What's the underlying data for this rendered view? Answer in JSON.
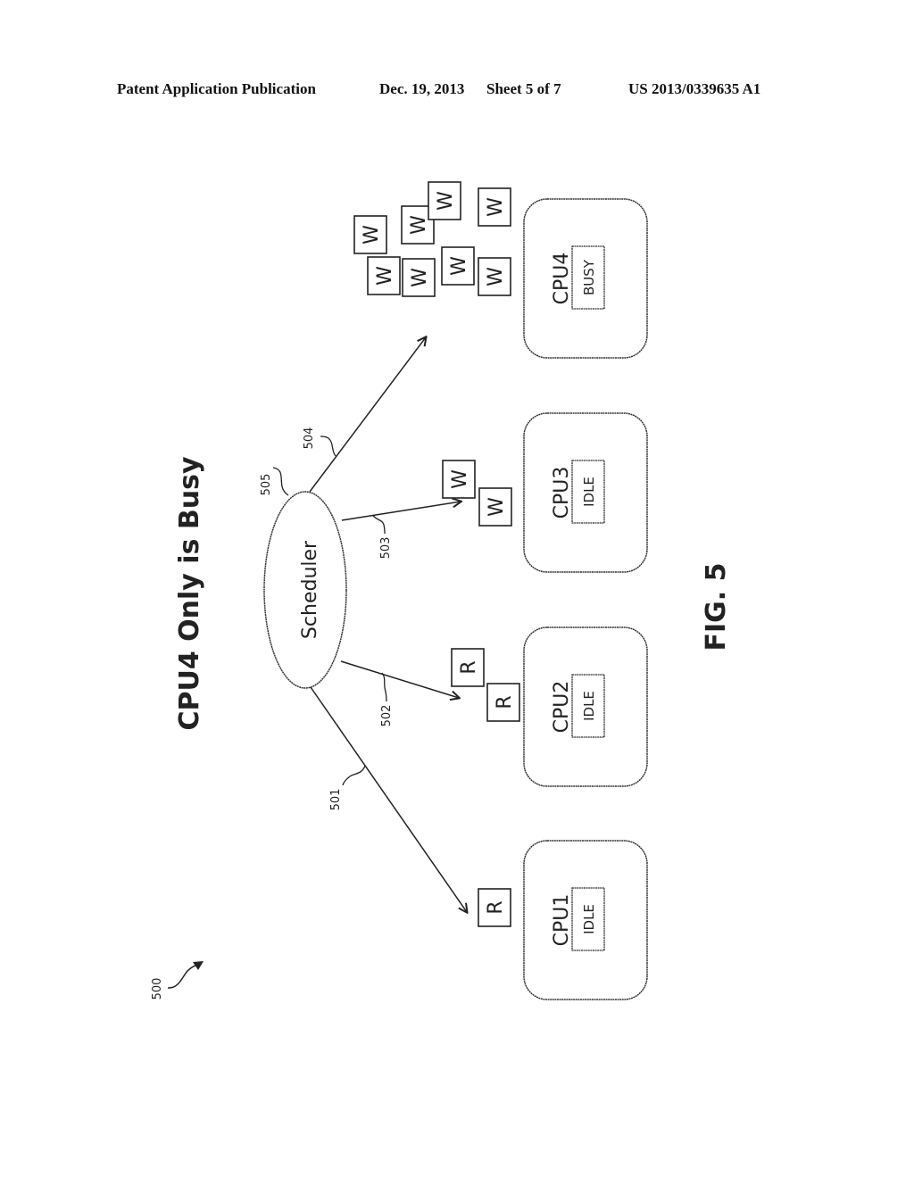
{
  "header": {
    "publication": "Patent Application Publication",
    "date": "Dec. 19, 2013",
    "sheet": "Sheet 5 of 7",
    "patent_number": "US 2013/0339635 A1"
  },
  "figure": {
    "title": "CPU4 Only is Busy",
    "caption": "FIG. 5",
    "ref_number": "500",
    "scheduler": {
      "label": "Scheduler",
      "ref": "505"
    },
    "arrows": [
      {
        "ref": "501",
        "target": "CPU1"
      },
      {
        "ref": "502",
        "target": "CPU2"
      },
      {
        "ref": "503",
        "target": "CPU3"
      },
      {
        "ref": "504",
        "target": "CPU4"
      }
    ],
    "cpus": [
      {
        "name": "CPU1",
        "status": "IDLE",
        "tasks": [
          "R"
        ]
      },
      {
        "name": "CPU2",
        "status": "IDLE",
        "tasks": [
          "R",
          "R"
        ]
      },
      {
        "name": "CPU3",
        "status": "IDLE",
        "tasks": [
          "W",
          "W"
        ]
      },
      {
        "name": "CPU4",
        "status": "BUSY",
        "tasks": [
          "W",
          "W",
          "W",
          "W",
          "W",
          "W",
          "W",
          "W"
        ]
      }
    ]
  }
}
